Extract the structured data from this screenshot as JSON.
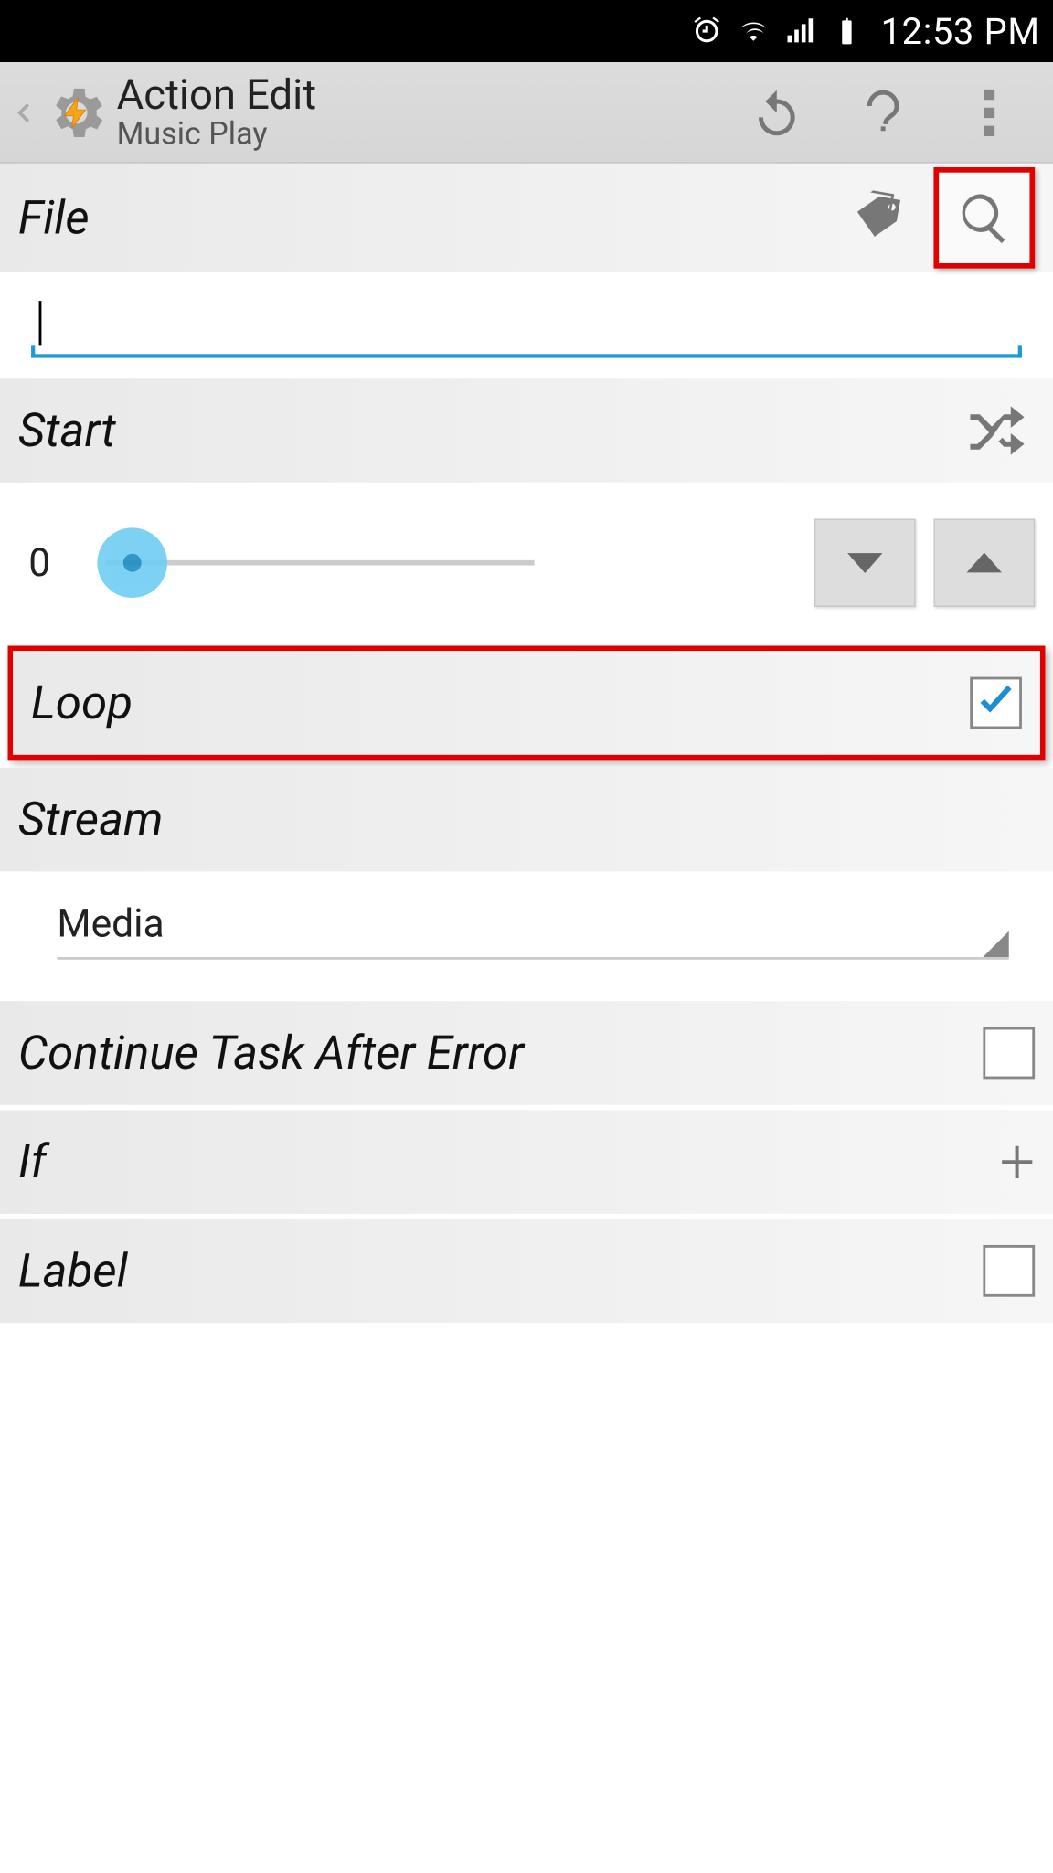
{
  "status": {
    "time": "12:53 PM"
  },
  "appbar": {
    "title": "Action Edit",
    "subtitle": "Music Play"
  },
  "file": {
    "label": "File",
    "value": ""
  },
  "start": {
    "label": "Start",
    "value": "0"
  },
  "loop": {
    "label": "Loop",
    "checked": true
  },
  "stream": {
    "label": "Stream",
    "selected": "Media"
  },
  "cte": {
    "label": "Continue Task After Error",
    "checked": false
  },
  "if_": {
    "label": "If"
  },
  "label_": {
    "label": "Label",
    "checked": false
  }
}
